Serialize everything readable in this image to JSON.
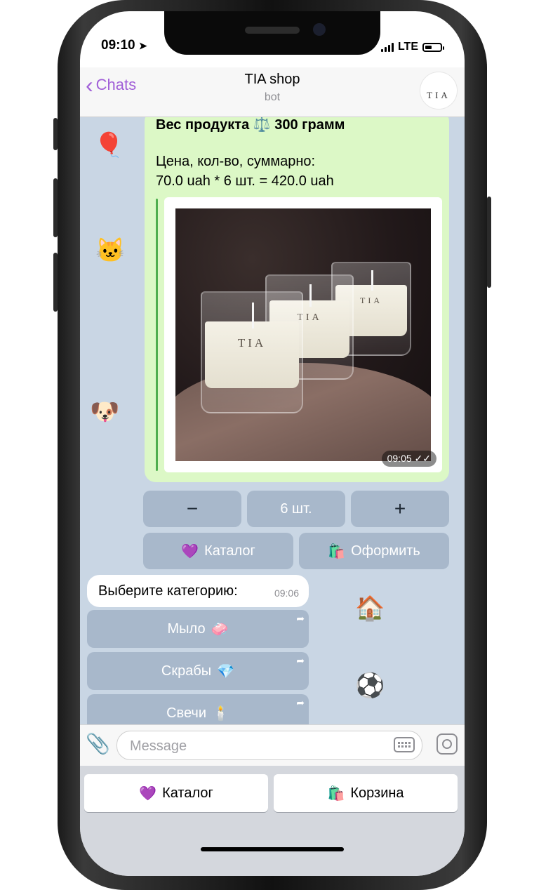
{
  "status": {
    "time": "09:10",
    "network": "LTE"
  },
  "header": {
    "back_label": "Chats",
    "title": "TIA shop",
    "subtitle": "bot",
    "avatar_text": "TIA"
  },
  "message": {
    "weight_line": "Вес продукта ⚖️ 300 грамм",
    "price_heading": "Цена, кол-во, суммарно:",
    "price_line": "70.0 uah * 6 шт. = 420.0 uah",
    "photo_brand": "TIA",
    "time": "09:05 ✓✓"
  },
  "inline_kb": {
    "minus": "−",
    "qty": "6 шт.",
    "plus": "+",
    "catalog_icon": "💜",
    "catalog": "Каталог",
    "checkout_icon": "🛍️",
    "checkout": "Оформить"
  },
  "incoming": {
    "text": "Выберите категорию:",
    "time": "09:06"
  },
  "categories": [
    {
      "label": "Мыло",
      "icon": "🧼"
    },
    {
      "label": "Скрабы",
      "icon": "💎"
    },
    {
      "label": "Свечи",
      "icon": "🕯️"
    }
  ],
  "composer": {
    "placeholder": "Message"
  },
  "reply_kb": {
    "catalog_icon": "💜",
    "catalog": "Каталог",
    "cart_icon": "🛍️",
    "cart": "Корзина"
  }
}
